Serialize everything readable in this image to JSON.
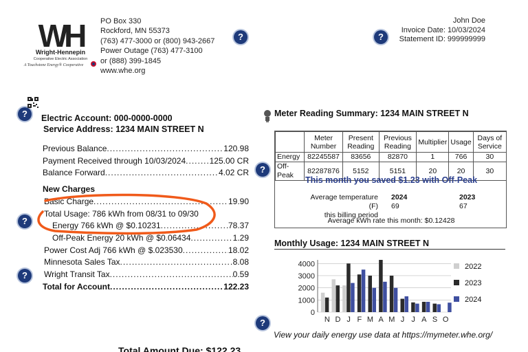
{
  "company": {
    "logo_initials": "WH",
    "name": "Wright-Hennepin",
    "subname": "Cooperative Electric Association",
    "tagline": "A Touchstone Energy® Cooperative"
  },
  "address": {
    "lines": [
      "PO Box 330",
      "Rockford, MN 55373",
      "(763) 477-3000 or (800) 943-2667",
      "Power Outage (763) 477-3100",
      "or (888) 399-1845",
      "www.whe.org"
    ]
  },
  "customer": {
    "name": "John Doe",
    "invoice_date": "Invoice Date: 10/03/2024",
    "statement_id": "Statement ID: 999999999"
  },
  "account": {
    "number_line": "Electric Account:  000-0000-0000",
    "service_line": "Service Address: 1234 MAIN STREET N"
  },
  "ledger": {
    "previous_balance": {
      "label": "Previous Balance",
      "amount": "120.98"
    },
    "payment": {
      "label": "Payment Received through 10/03/2024",
      "amount": "125.00 CR"
    },
    "balance_forward": {
      "label": "Balance Forward",
      "amount": "4.02 CR"
    },
    "new_charges_header": "New Charges",
    "basic_charge": {
      "label": "Basic Charge",
      "amount": "19.90"
    },
    "total_usage": "Total Usage: 786 kWh from 08/31 to 09/30",
    "energy": {
      "label": "Energy 766 kWh @ $0.10231",
      "amount": "78.37"
    },
    "offpeak": {
      "label": "Off-Peak Energy 20 kWh @ $0.06434",
      "amount": "1.29"
    },
    "power_cost": {
      "label": "Power Cost Adj 766 kWh @ $.023530",
      "amount": "18.02"
    },
    "sales_tax": {
      "label": "Minnesota Sales Tax",
      "amount": "8.08"
    },
    "transit_tax": {
      "label": "Wright Transit Tax",
      "amount": "0.59"
    },
    "total": {
      "label": "Total for Account",
      "amount": "122.23"
    }
  },
  "meter_reading": {
    "title": "Meter Reading Summary:  1234 MAIN STREET N",
    "headers": [
      "",
      "Meter Number",
      "Present Reading",
      "Previous Reading",
      "Multiplier",
      "Usage",
      "Days of Service"
    ],
    "rows": [
      [
        "Energy",
        "82245587",
        "83656",
        "82870",
        "1",
        "766",
        "30"
      ],
      [
        "Off-Peak",
        "82287876",
        "5152",
        "5151",
        "20",
        "20",
        "30"
      ]
    ],
    "savings": "This month you saved $1.23 with Off-Peak",
    "temp_label_1": "Average temperature (F)",
    "temp_label_2": "this billing period",
    "year_a": "2024",
    "year_b": "2023",
    "temp_a": "69",
    "temp_b": "67",
    "avg_rate": "Average kWh rate this month: $0.12428"
  },
  "monthly_usage": {
    "title": "Monthly Usage:  1234 MAIN STREET N",
    "footer": "View your daily energy use data at https://mymeter.whe.org/"
  },
  "total_due": "Total Amount Due:  $122.23",
  "help_icon": "?",
  "colors": {
    "accent": "#1e3a7a",
    "highlight": "#f05a1a",
    "y2022": "#cfcfcf",
    "y2023": "#2b2b2b",
    "y2024": "#3f4fa0"
  },
  "chart_data": {
    "type": "bar",
    "categories": [
      "N",
      "D",
      "J",
      "F",
      "M",
      "A",
      "M",
      "J",
      "J",
      "A",
      "S",
      "O"
    ],
    "series": [
      {
        "name": "2022",
        "values": [
          1600,
          2700,
          2200,
          null,
          null,
          null,
          null,
          null,
          null,
          null,
          null,
          null
        ]
      },
      {
        "name": "2023",
        "values": [
          1200,
          2200,
          4000,
          3100,
          3000,
          4300,
          3000,
          1100,
          800,
          850,
          700,
          null
        ]
      },
      {
        "name": "2024",
        "values": [
          null,
          null,
          2400,
          3500,
          2000,
          2500,
          2000,
          1300,
          700,
          850,
          650,
          780
        ]
      }
    ],
    "yticks": [
      0,
      1000,
      2000,
      3000,
      4000
    ],
    "ylim": [
      0,
      4300
    ],
    "legend_position": "right"
  }
}
